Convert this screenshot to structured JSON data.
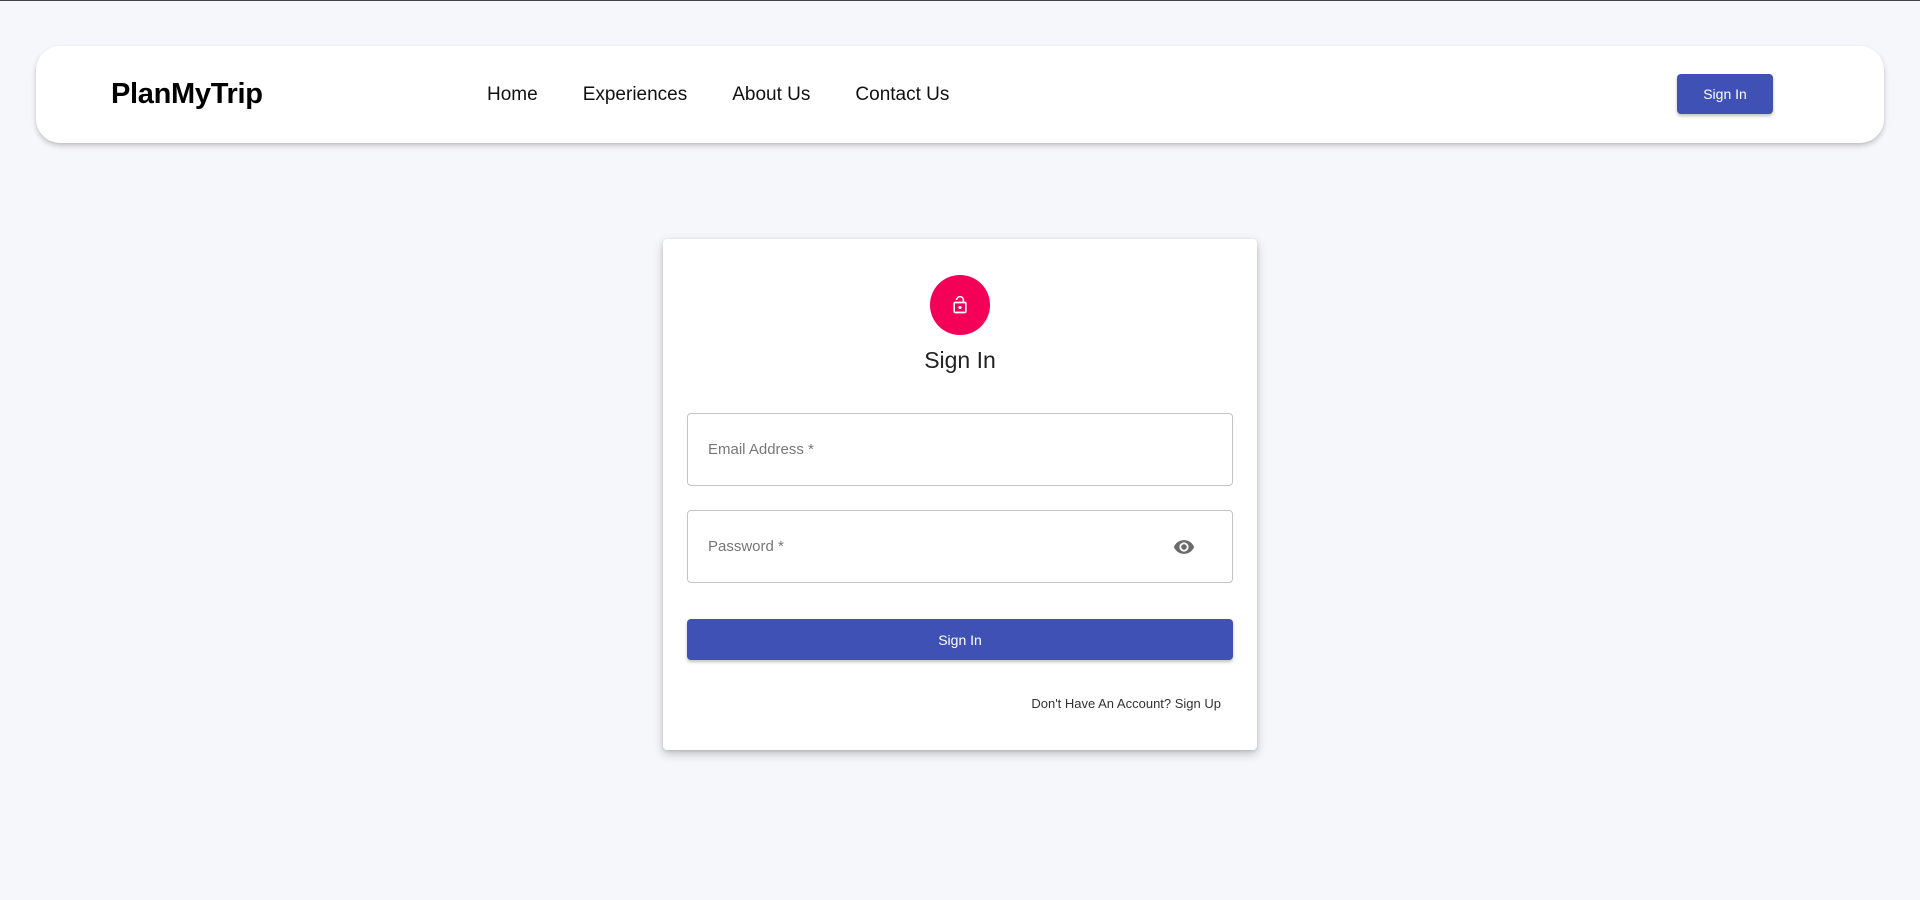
{
  "header": {
    "brand": "PlanMyTrip",
    "nav": [
      {
        "label": "Home"
      },
      {
        "label": "Experiences"
      },
      {
        "label": "About Us"
      },
      {
        "label": "Contact Us"
      }
    ],
    "signin_label": "Sign In"
  },
  "login": {
    "icon": "lock-icon",
    "title": "Sign In",
    "email": {
      "placeholder": "Email Address *",
      "value": ""
    },
    "password": {
      "placeholder": "Password *",
      "value": "",
      "toggle_icon": "eye-icon"
    },
    "submit_label": "Sign In",
    "signup_link": "Don't Have An Account? Sign Up"
  },
  "colors": {
    "primary": "#3f51b5",
    "accent": "#f50057",
    "background": "#f6f7fb"
  }
}
